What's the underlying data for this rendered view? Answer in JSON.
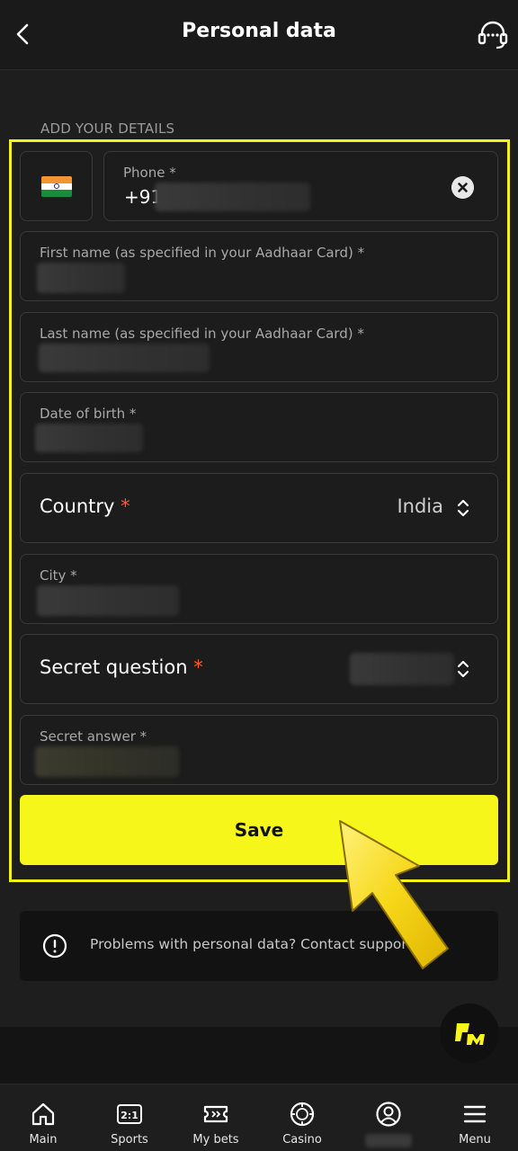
{
  "header": {
    "title": "Personal data"
  },
  "section_label": "ADD YOUR DETAILS",
  "phone": {
    "label": "Phone *",
    "prefix": "+91"
  },
  "fields": {
    "first_name": "First name (as specified in your Aadhaar Card) *",
    "last_name": "Last name (as specified in your Aadhaar Card) *",
    "dob": "Date of birth *",
    "country_label": "Country",
    "country_value": "India",
    "city": "City *",
    "secret_question": "Secret question",
    "secret_answer": "Secret answer *",
    "required_mark": "*"
  },
  "save_label": "Save",
  "info_text": "Problems with personal data? Contact support",
  "nav": {
    "main": "Main",
    "sports": "Sports",
    "my_bets": "My bets",
    "casino": "Casino",
    "menu": "Menu"
  },
  "colors": {
    "accent": "#f6f61a",
    "required": "#ff5a2b",
    "highlight_border": "#f4f21c"
  },
  "icons": [
    "back-arrow-icon",
    "headset-support-icon",
    "india-flag-icon",
    "clear-icon",
    "updown-chevron-icon",
    "info-icon",
    "pm-logo-icon",
    "home-icon",
    "sports-icon",
    "ticket-icon",
    "casino-chip-icon",
    "user-icon",
    "menu-icon"
  ]
}
